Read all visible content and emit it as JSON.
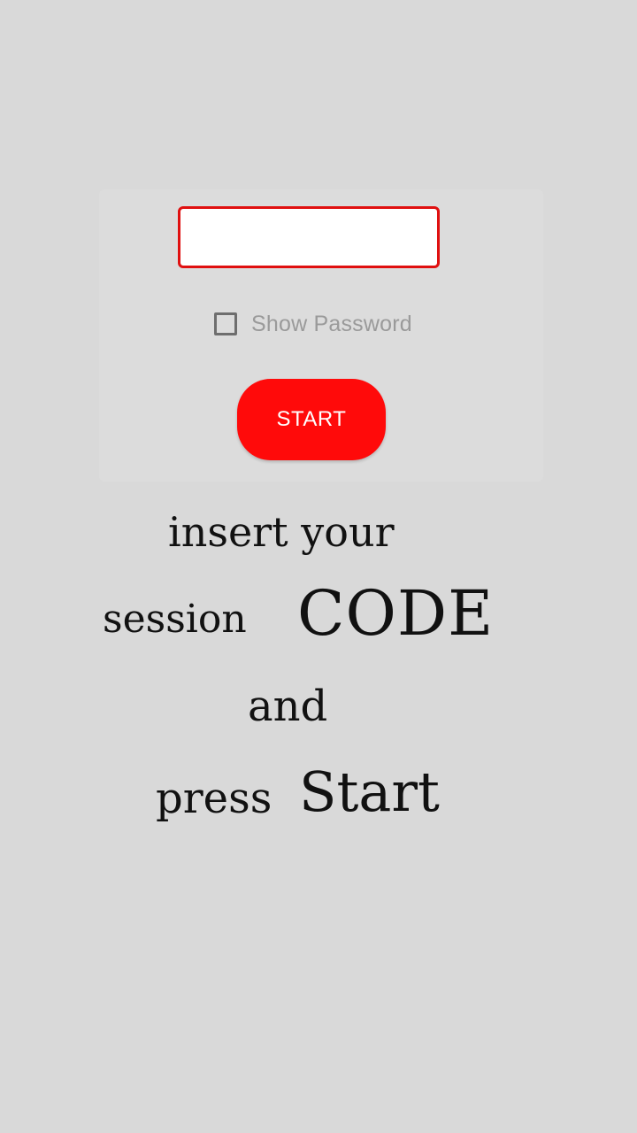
{
  "login_panel": {
    "code_input": {
      "value": "",
      "placeholder": ""
    },
    "show_password": {
      "label": "Show Password",
      "checked": false
    },
    "start_button_label": "START"
  },
  "instructions": {
    "line1": "insert your",
    "line2_small": "session",
    "line2_large": "CODE",
    "line3": "and",
    "line4_small": "press",
    "line4_large": "Start"
  },
  "colors": {
    "background": "#d9d9d9",
    "accent": "#ff0a0a",
    "input_border": "#e01010"
  }
}
